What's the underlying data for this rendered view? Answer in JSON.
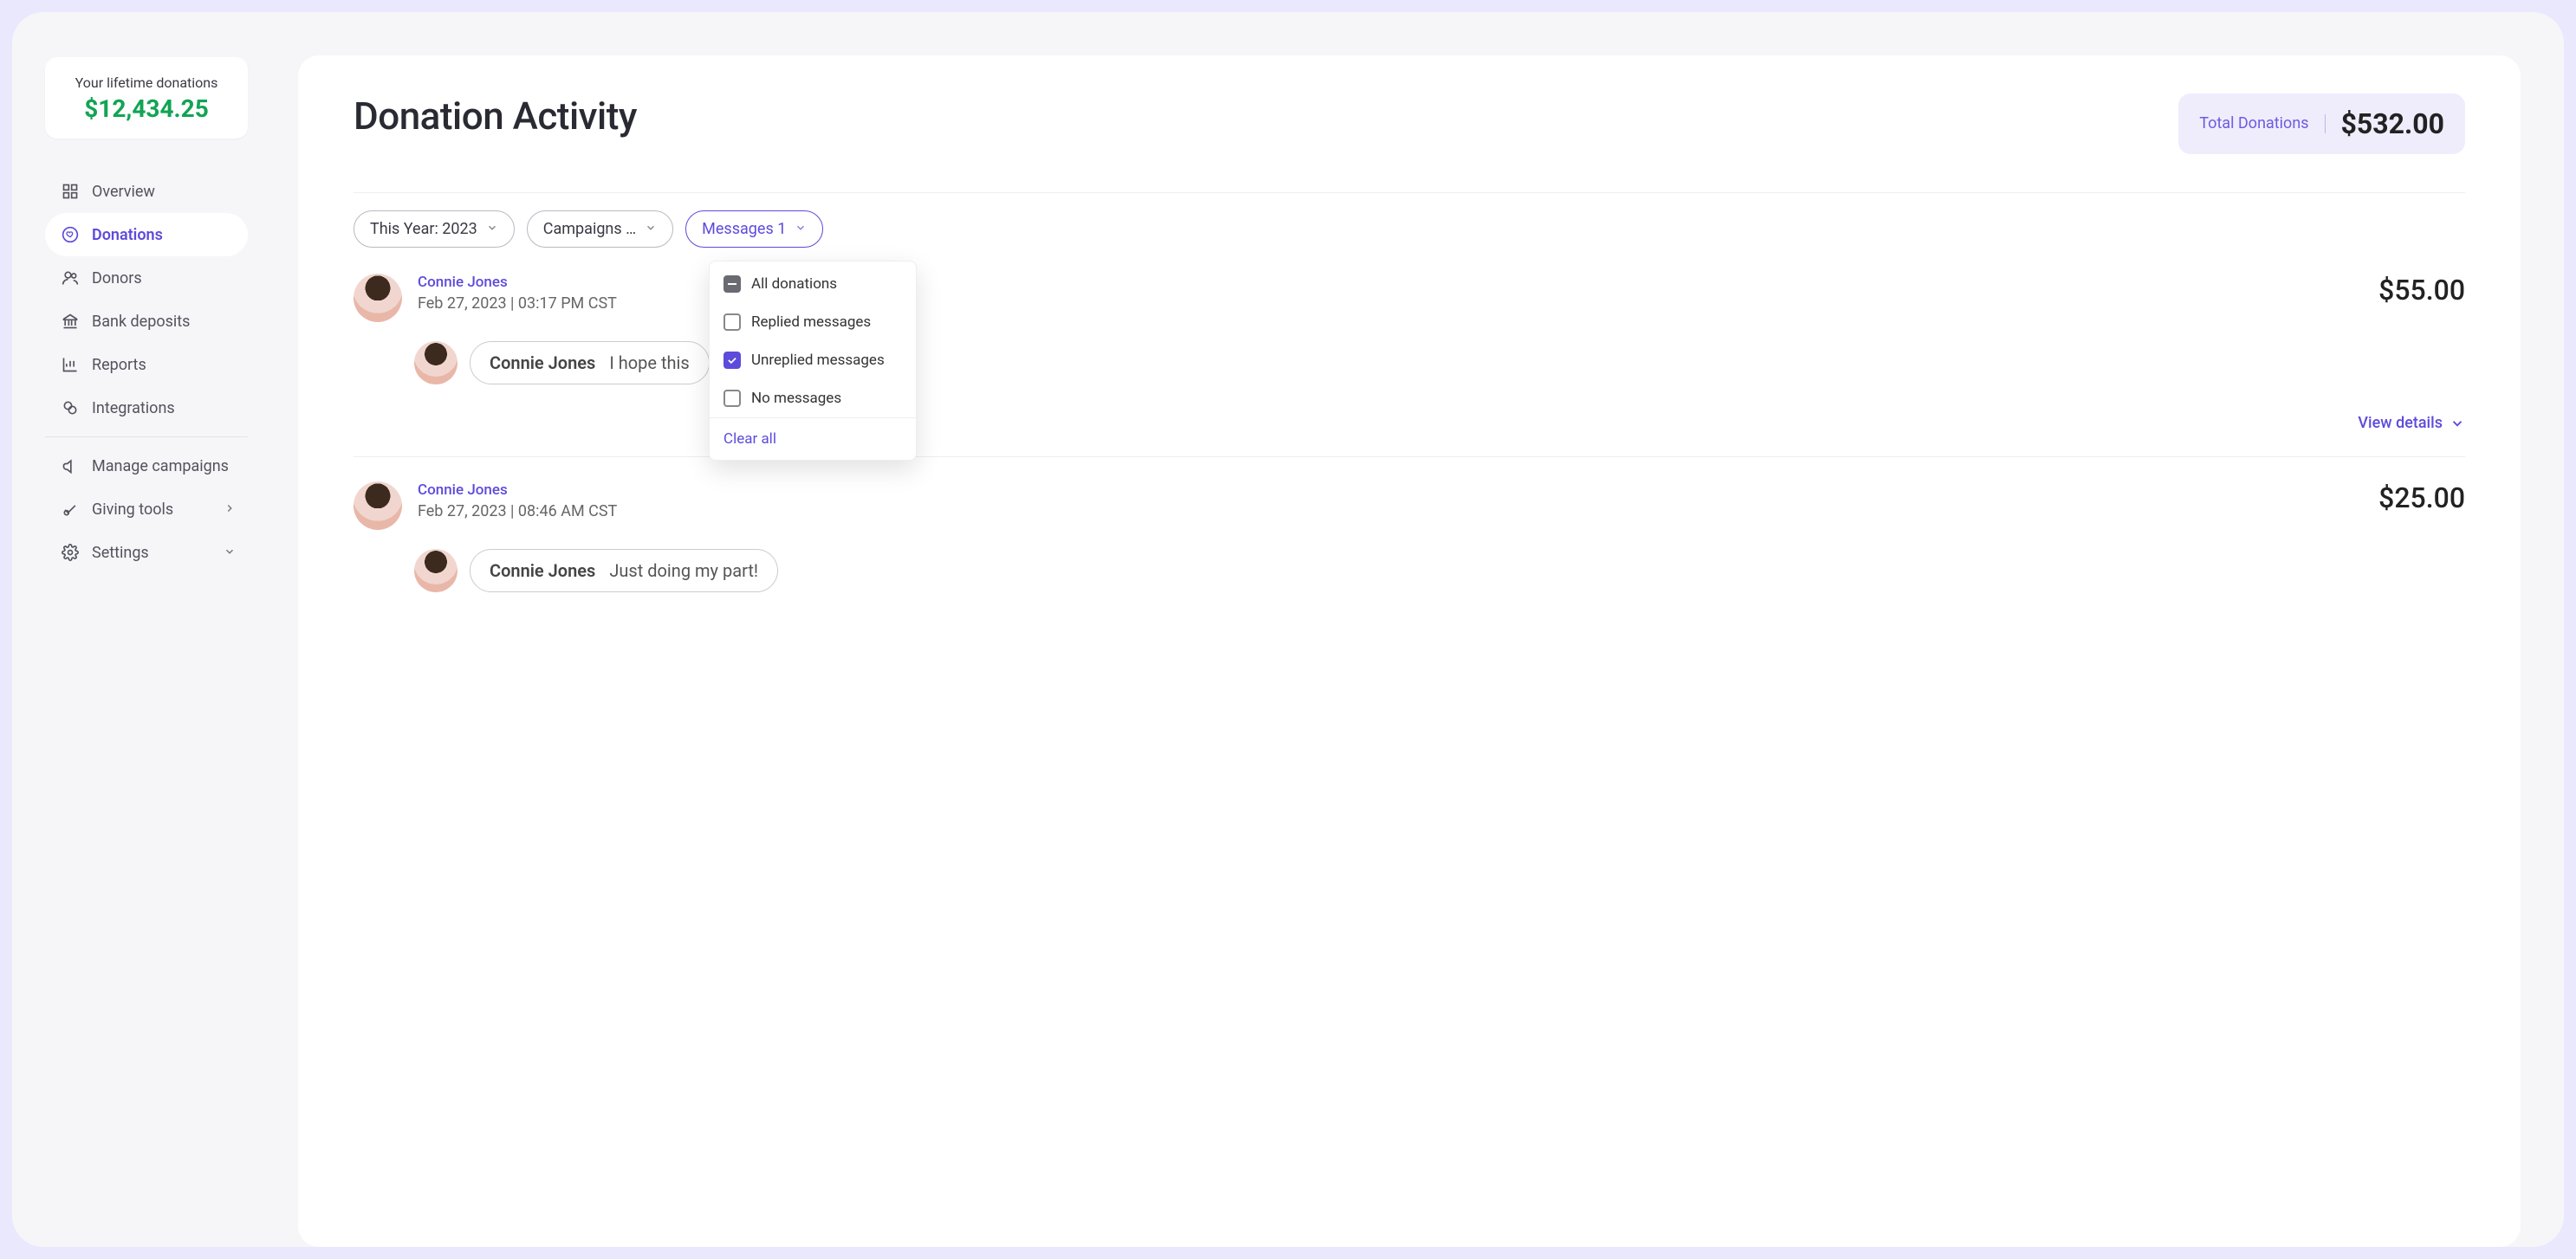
{
  "sidebar": {
    "lifetime_label": "Your lifetime donations",
    "lifetime_amount": "$12,434.25",
    "items": [
      {
        "label": "Overview",
        "icon": "grid-icon",
        "active": false
      },
      {
        "label": "Donations",
        "icon": "heart-icon",
        "active": true
      },
      {
        "label": "Donors",
        "icon": "users-icon",
        "active": false
      },
      {
        "label": "Bank deposits",
        "icon": "bank-icon",
        "active": false
      },
      {
        "label": "Reports",
        "icon": "chart-icon",
        "active": false
      },
      {
        "label": "Integrations",
        "icon": "link-icon",
        "active": false
      }
    ],
    "items2": [
      {
        "label": "Manage campaigns",
        "icon": "megaphone-icon",
        "chevron": null
      },
      {
        "label": "Giving tools",
        "icon": "rocket-icon",
        "chevron": "right"
      },
      {
        "label": "Settings",
        "icon": "gear-icon",
        "chevron": "down"
      }
    ]
  },
  "main": {
    "title": "Donation Activity",
    "total_label": "Total Donations",
    "total_amount": "$532.00",
    "filters": {
      "year": "This Year: 2023",
      "campaigns": "Campaigns …",
      "messages": "Messages 1"
    },
    "messages_dropdown": {
      "all": "All donations",
      "replied": "Replied messages",
      "unreplied": "Unreplied messages",
      "none": "No messages",
      "clear": "Clear all"
    },
    "activity": [
      {
        "name": "Connie Jones",
        "date": "Feb 27, 2023 | 03:17 PM CST",
        "amount": "$55.00",
        "message_name": "Connie Jones",
        "message_text": "I hope this",
        "view_details": "View details"
      },
      {
        "name": "Connie Jones",
        "date": "Feb 27, 2023 | 08:46 AM CST",
        "amount": "$25.00",
        "message_name": "Connie Jones",
        "message_text": "Just doing my part!"
      }
    ]
  }
}
